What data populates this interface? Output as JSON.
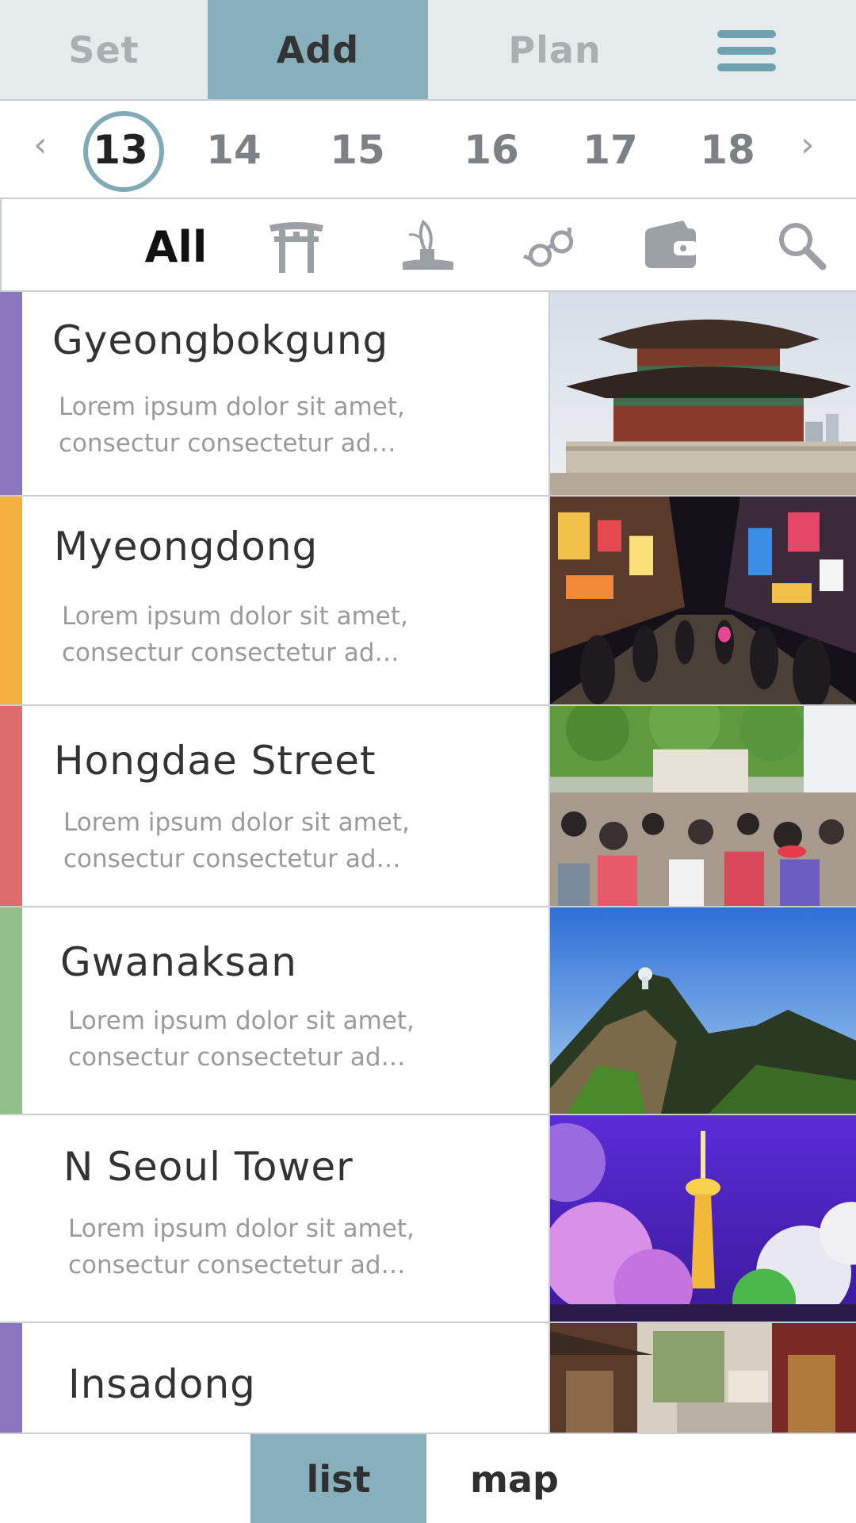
{
  "header": {
    "tabs": [
      {
        "label": "Set",
        "active": false
      },
      {
        "label": "Add",
        "active": true
      },
      {
        "label": "Plan",
        "active": false
      }
    ],
    "menu_icon": "hamburger-menu-icon",
    "accent_color": "#87b0bc"
  },
  "dates": {
    "prev_icon": "chevron-left-icon",
    "next_icon": "chevron-right-icon",
    "days": [
      "13",
      "14",
      "15",
      "16",
      "17",
      "18"
    ],
    "selected": "13"
  },
  "filters": {
    "all_label": "All",
    "icons": [
      "torii-gate-icon",
      "plant-icon",
      "glasses-icon",
      "wallet-icon",
      "search-icon"
    ]
  },
  "places": [
    {
      "name": "Gyeongbokgung",
      "description": "Lorem ipsum dolor sit amet, consectur consectetur ad…",
      "color": "#8a76bd"
    },
    {
      "name": "Myeongdong",
      "description": "Lorem ipsum dolor sit amet, consectur consectetur ad…",
      "color": "#f4b13f"
    },
    {
      "name": "Hongdae Street",
      "description": "Lorem ipsum dolor sit amet, consectur consectetur ad…",
      "color": "#dc6b6e"
    },
    {
      "name": "Gwanaksan",
      "description": "Lorem ipsum dolor sit amet, consectur consectetur ad…",
      "color": "#92c08c"
    },
    {
      "name": "N Seoul Tower",
      "description": "Lorem ipsum dolor sit amet, consectur consectetur ad…",
      "color": "#ffffff"
    },
    {
      "name": "Insadong",
      "description": "",
      "color": "#8a76bd"
    }
  ],
  "view_toggle": {
    "list_label": "list",
    "map_label": "map",
    "active": "list"
  }
}
